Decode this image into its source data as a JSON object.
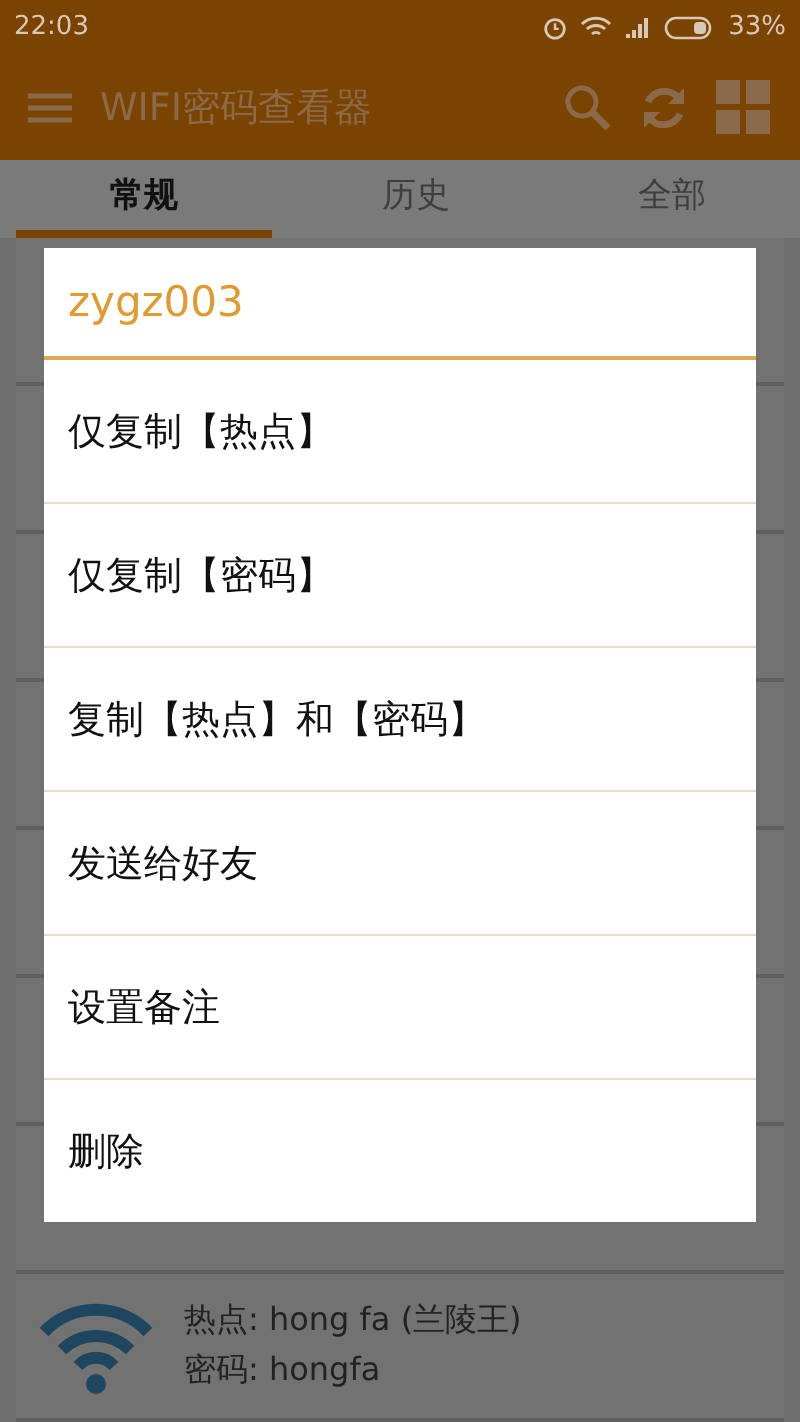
{
  "status_bar": {
    "time": "22:03",
    "battery": "33%"
  },
  "app_bar": {
    "title": "WIFI密码查看器"
  },
  "tabs": [
    {
      "label": "常规",
      "selected": true
    },
    {
      "label": "历史",
      "selected": false
    },
    {
      "label": "全部",
      "selected": false
    }
  ],
  "dialog": {
    "title": "zygz003",
    "options": [
      "仅复制【热点】",
      "仅复制【密码】",
      "复制【热点】和【密码】",
      "发送给好友",
      "设置备注",
      "删除"
    ]
  },
  "list": {
    "visible_item": {
      "hotspot": "热点: hong fa (兰陵王)",
      "password": "密码: hongfa"
    }
  }
}
